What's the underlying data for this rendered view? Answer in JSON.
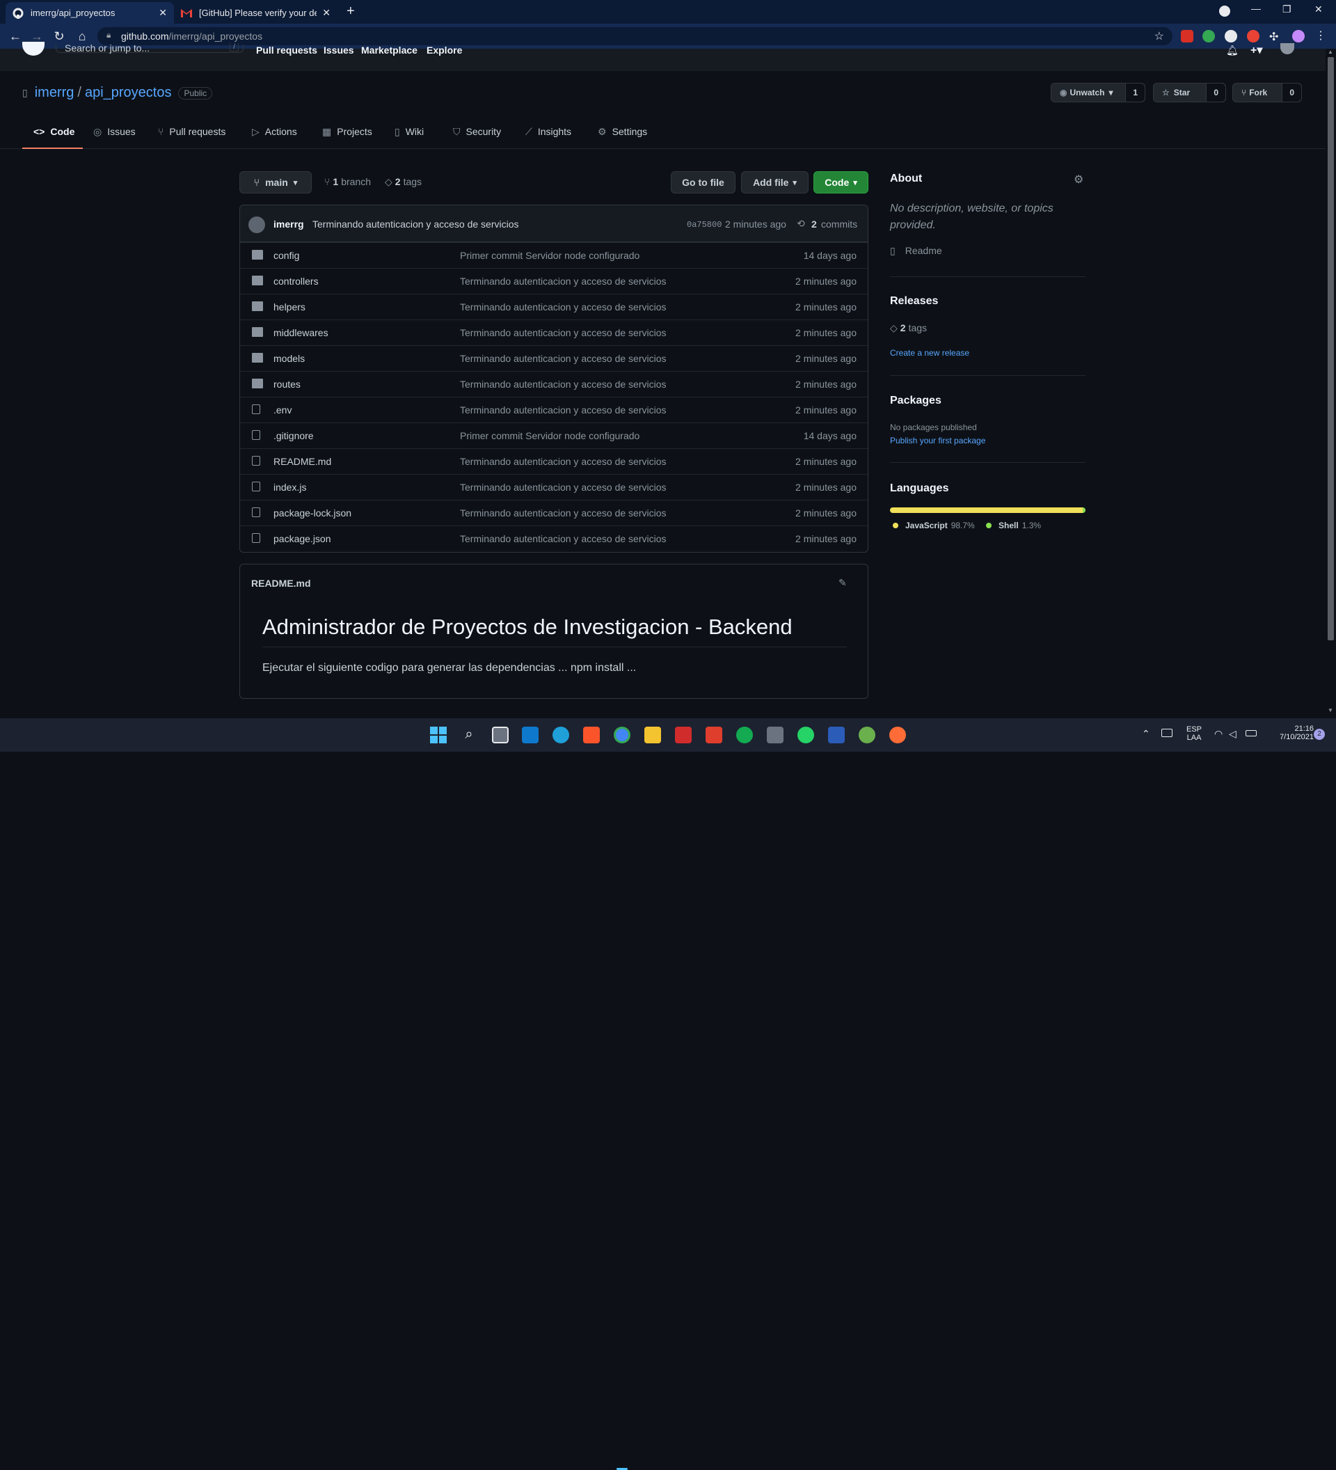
{
  "browser": {
    "tabs": [
      {
        "title": "imerrg/api_proyectos",
        "close": "✕"
      },
      {
        "title": "[GitHub] Please verify your devic",
        "close": "✕"
      }
    ],
    "new_tab": "+",
    "url_host": "github.com",
    "url_path": "/imerrg/api_proyectos",
    "window_controls": [
      "—",
      "❐",
      "✕"
    ]
  },
  "gh_header": {
    "search_placeholder": "Search or jump to...",
    "search_key": "/",
    "links": [
      "Pull requests",
      "Issues",
      "Marketplace",
      "Explore"
    ]
  },
  "repo": {
    "owner": "imerrg",
    "separator": "/",
    "name": "api_proyectos",
    "visibility": "Public",
    "unwatch_label": "Unwatch",
    "watch_count": "1",
    "star_label": "Star",
    "star_count": "0",
    "fork_label": "Fork",
    "fork_count": "0",
    "tabs": [
      {
        "label": "Code",
        "icon": "<>"
      },
      {
        "label": "Issues",
        "icon": "◎"
      },
      {
        "label": "Pull requests",
        "icon": "⑂"
      },
      {
        "label": "Actions",
        "icon": "▷"
      },
      {
        "label": "Projects",
        "icon": "▦"
      },
      {
        "label": "Wiki",
        "icon": "▯"
      },
      {
        "label": "Security",
        "icon": "⛉"
      },
      {
        "label": "Insights",
        "icon": "⟋"
      },
      {
        "label": "Settings",
        "icon": "⚙"
      }
    ]
  },
  "toolbar": {
    "branch": "main",
    "branch_count": "1",
    "branch_label": "branch",
    "tag_count": "2",
    "tag_label": "tags",
    "go_to_file": "Go to file",
    "add_file": "Add file",
    "code": "Code"
  },
  "commit": {
    "author": "imerrg",
    "message": "Terminando autenticacion y acceso de servicios",
    "sha": "0a75800",
    "time": "2 minutes ago",
    "count": "2",
    "count_label": "commits"
  },
  "files": [
    {
      "name": "config",
      "type": "dir",
      "message": "Primer commit Servidor node configurado",
      "time": "14 days ago"
    },
    {
      "name": "controllers",
      "type": "dir",
      "message": "Terminando autenticacion y acceso de servicios",
      "time": "2 minutes ago"
    },
    {
      "name": "helpers",
      "type": "dir",
      "message": "Terminando autenticacion y acceso de servicios",
      "time": "2 minutes ago"
    },
    {
      "name": "middlewares",
      "type": "dir",
      "message": "Terminando autenticacion y acceso de servicios",
      "time": "2 minutes ago"
    },
    {
      "name": "models",
      "type": "dir",
      "message": "Terminando autenticacion y acceso de servicios",
      "time": "2 minutes ago"
    },
    {
      "name": "routes",
      "type": "dir",
      "message": "Terminando autenticacion y acceso de servicios",
      "time": "2 minutes ago"
    },
    {
      "name": ".env",
      "type": "file",
      "message": "Terminando autenticacion y acceso de servicios",
      "time": "2 minutes ago"
    },
    {
      "name": ".gitignore",
      "type": "file",
      "message": "Primer commit Servidor node configurado",
      "time": "14 days ago"
    },
    {
      "name": "README.md",
      "type": "file",
      "message": "Terminando autenticacion y acceso de servicios",
      "time": "2 minutes ago"
    },
    {
      "name": "index.js",
      "type": "file",
      "message": "Terminando autenticacion y acceso de servicios",
      "time": "2 minutes ago"
    },
    {
      "name": "package-lock.json",
      "type": "file",
      "message": "Terminando autenticacion y acceso de servicios",
      "time": "2 minutes ago"
    },
    {
      "name": "package.json",
      "type": "file",
      "message": "Terminando autenticacion y acceso de servicios",
      "time": "2 minutes ago"
    }
  ],
  "readme": {
    "filename": "README.md",
    "heading": "Administrador de Proyectos de Investigacion - Backend",
    "body": "Ejecutar el siguiente codigo para generar las dependencias ... npm install ..."
  },
  "sidebar": {
    "about_title": "About",
    "about_text": "No description, website, or topics provided.",
    "readme_label": "Readme",
    "releases_title": "Releases",
    "tags_count": "2",
    "tags_label": "tags",
    "create_release": "Create a new release",
    "packages_title": "Packages",
    "packages_text": "No packages published",
    "publish_package": "Publish your first package",
    "languages_title": "Languages",
    "languages": [
      {
        "name": "JavaScript",
        "percent": "98.7%",
        "value": 98.7,
        "color": "#f1e05a"
      },
      {
        "name": "Shell",
        "percent": "1.3%",
        "value": 1.3,
        "color": "#89e051"
      }
    ]
  },
  "taskbar": {
    "lang": "ESP",
    "layout": "LAA",
    "time": "21:16",
    "date": "7/10/2021",
    "notifications": "2"
  },
  "colors": {
    "accent_link": "#58a6ff",
    "green_button": "#238636",
    "selected_tab_underline": "#f78166"
  }
}
